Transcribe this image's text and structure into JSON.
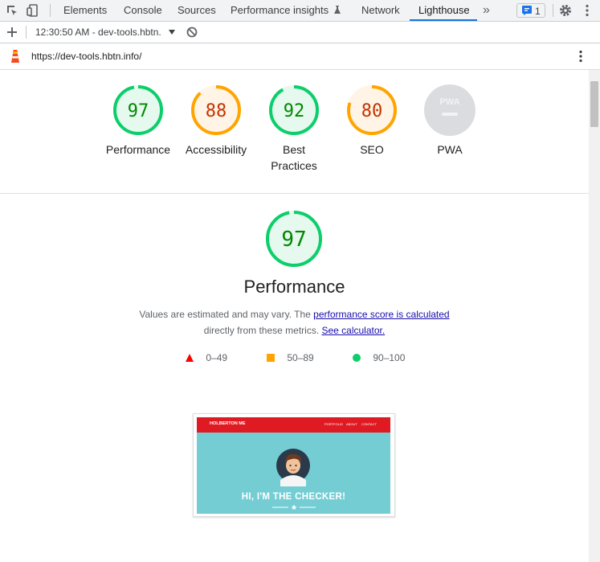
{
  "devtools": {
    "tabs": [
      "Elements",
      "Console",
      "Sources",
      "Performance insights",
      "Network",
      "Lighthouse"
    ],
    "active_tab": "Lighthouse",
    "more_tabs": "»",
    "issues_count": "1",
    "report_selector": "12:30:50 AM - dev-tools.hbtn.",
    "url": "https://dev-tools.hbtn.info/"
  },
  "scores": [
    {
      "label_lines": [
        "Performance"
      ],
      "value": "97",
      "status": "pass",
      "fraction": 0.97
    },
    {
      "label_lines": [
        "Accessibility"
      ],
      "value": "88",
      "status": "average",
      "fraction": 0.88
    },
    {
      "label_lines": [
        "Best",
        "Practices"
      ],
      "value": "92",
      "status": "pass",
      "fraction": 0.92
    },
    {
      "label_lines": [
        "SEO"
      ],
      "value": "80",
      "status": "average",
      "fraction": 0.8
    },
    {
      "label_lines": [
        "PWA"
      ],
      "value": "PWA",
      "status": "na",
      "fraction": 0
    }
  ],
  "performance": {
    "score": "97",
    "fraction": 0.97,
    "title": "Performance",
    "desc_prefix": "Values are estimated and may vary. The ",
    "desc_link1": "performance score is calculated",
    "desc_mid": "directly from these metrics. ",
    "desc_link2": "See calculator."
  },
  "legend": {
    "fail": "0–49",
    "average": "50–89",
    "pass": "90–100"
  },
  "screenshot": {
    "site_name": "HOLBERTON ME",
    "nav": [
      "PORTFOLIO",
      "ABOUT",
      "CONTACT"
    ],
    "headline": "HI, I'M THE CHECKER!"
  },
  "colors": {
    "pass": "#0cce6b",
    "pass_fill": "#e6f9ee",
    "pass_text": "#008800",
    "average": "#ffa400",
    "average_fill": "#fff4e5",
    "average_text": "#c33300",
    "fail": "#ff4e42",
    "na": "#dadce0"
  }
}
